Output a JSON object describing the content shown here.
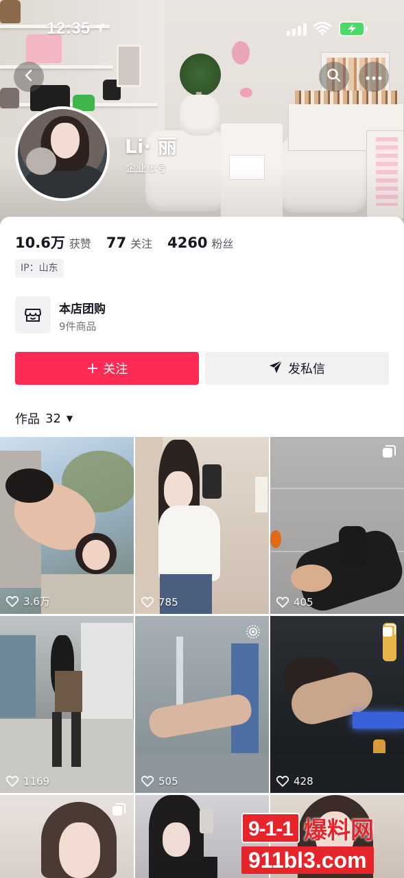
{
  "status_bar": {
    "time": "12:35"
  },
  "profile": {
    "name": "Li· 丽",
    "account_type": "企业账号",
    "stats": [
      {
        "value": "10.6万",
        "label": "获赞"
      },
      {
        "value": "77",
        "label": "关注"
      },
      {
        "value": "4260",
        "label": "粉丝"
      }
    ],
    "ip_tag": "IP：山东"
  },
  "shop": {
    "title": "本店团购",
    "subtitle": "9件商品",
    "icon": "storefront-icon"
  },
  "actions": {
    "follow_label": "关注",
    "message_label": "发私信"
  },
  "works_tab": {
    "label": "作品",
    "count": "32"
  },
  "grid": [
    {
      "likes": "3.6万"
    },
    {
      "likes": "785"
    },
    {
      "likes": "405"
    },
    {
      "likes": "1169"
    },
    {
      "likes": "505"
    },
    {
      "likes": "428"
    }
  ],
  "watermark": {
    "badge": "9-1-1",
    "brand": "爆料网",
    "url": "911bl3.com"
  },
  "colors": {
    "accent": "#fe2c55",
    "secondary_button": "#f1f1f2",
    "watermark": "#e8242b"
  }
}
